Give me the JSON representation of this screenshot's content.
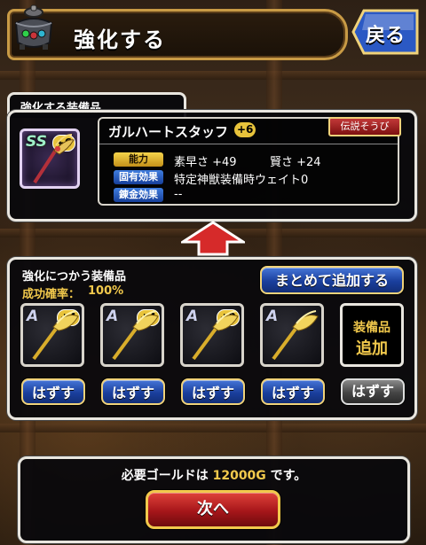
{
  "header": {
    "title": "強化する",
    "back_label": "戻る"
  },
  "target_section": {
    "tab_label": "強化する装備品",
    "item": {
      "name": "ガルハートスタッフ",
      "plus": "+6",
      "icon_rank": "SS",
      "rarity_badge": "伝説そうび",
      "stats_label": "能力",
      "stat1": "素早さ +49",
      "stat2": "賢さ +24",
      "unique_label": "固有効果",
      "unique_value": "特定神獣装備時ウェイト0",
      "alchemy_label": "錬金効果",
      "alchemy_value": "--"
    }
  },
  "material_section": {
    "tab_label": "強化につかう装備品",
    "success_label": "成功確率：",
    "success_rate": "100%",
    "bulk_add_label": "まとめて追加する",
    "materials": [
      {
        "rank": "A",
        "plus": "+4",
        "remove_label": "はずす"
      },
      {
        "rank": "A",
        "plus": "+4",
        "remove_label": "はずす"
      },
      {
        "rank": "A",
        "plus": "+2",
        "remove_label": "はずす"
      },
      {
        "rank": "A",
        "plus": "",
        "remove_label": "はずす"
      }
    ],
    "add_slot": {
      "line1": "装備品",
      "line2": "追加",
      "remove_label": "はずす"
    }
  },
  "footer": {
    "gold_prefix": "必要ゴールドは",
    "gold_amount": "12000G",
    "gold_suffix": "です。",
    "next_label": "次へ"
  },
  "colors": {
    "gold": "#f2c94c",
    "frame": "#c89a45",
    "blue_btn": "#1a3f9d",
    "red_btn": "#a6161a"
  }
}
